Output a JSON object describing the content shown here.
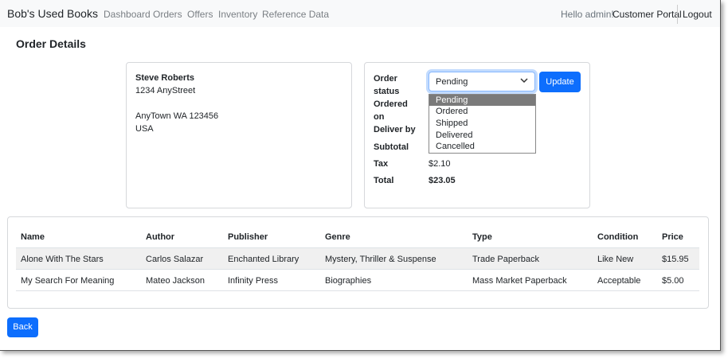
{
  "navbar": {
    "brand": "Bob's Used Books",
    "links": [
      "Dashboard",
      "Orders",
      "Offers",
      "Inventory",
      "Reference Data"
    ],
    "greeting": "Hello admin!",
    "customer_portal": "Customer Portal",
    "logout": "Logout"
  },
  "page": {
    "title": "Order Details"
  },
  "address": {
    "name": "Steve Roberts",
    "street": "1234 AnyStreet",
    "city_state_zip": "AnyTown WA 123456",
    "country": "USA"
  },
  "order": {
    "status_label": [
      "Order",
      "status"
    ],
    "ordered_on_label": [
      "Ordered",
      "on"
    ],
    "deliver_by_label": "Deliver by",
    "subtotal_label": "Subtotal",
    "tax_label": "Tax",
    "tax_value": "$2.10",
    "total_label": "Total",
    "total_value": "$23.05",
    "status_selected": "Pending",
    "status_options": [
      "Pending",
      "Ordered",
      "Shipped",
      "Delivered",
      "Cancelled"
    ],
    "update_button": "Update"
  },
  "items_table": {
    "columns": [
      "Name",
      "Author",
      "Publisher",
      "Genre",
      "Type",
      "Condition",
      "Price"
    ],
    "rows": [
      [
        "Alone With The Stars",
        "Carlos Salazar",
        "Enchanted Library",
        "Mystery, Thriller & Suspense",
        "Trade Paperback",
        "Like New",
        "$15.95"
      ],
      [
        "My Search For Meaning",
        "Mateo Jackson",
        "Infinity Press",
        "Biographies",
        "Mass Market Paperback",
        "Acceptable",
        "$5.00"
      ]
    ]
  },
  "back_button": "Back",
  "colors": {
    "primary": "#0d6efd",
    "navbar_bg": "#f8f9fa",
    "selected_option_bg": "#7a7a7a"
  }
}
